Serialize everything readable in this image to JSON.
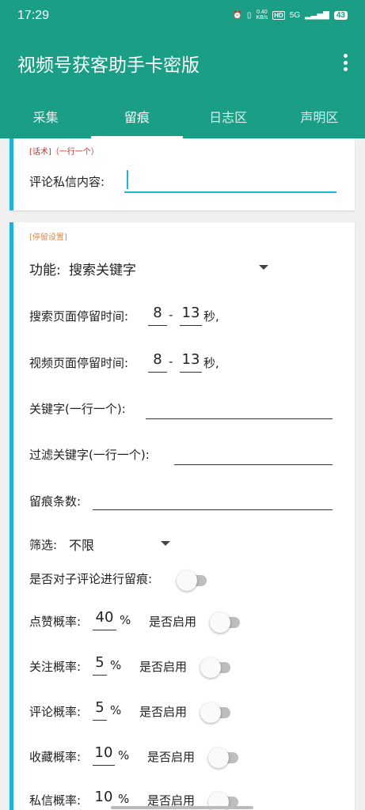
{
  "status_bar": {
    "time": "17:29",
    "net_speed": "0.40",
    "net_unit": "KB/s",
    "hd": "HD",
    "network": "5G",
    "battery": "43"
  },
  "app": {
    "title": "视频号获客助手卡密版"
  },
  "tabs": [
    {
      "label": "采集"
    },
    {
      "label": "留痕"
    },
    {
      "label": "日志区"
    },
    {
      "label": "声明区"
    }
  ],
  "script_section": {
    "tag": "[话术]（一行一个）",
    "comment_label": "评论私信内容:",
    "comment_value": ""
  },
  "stay_section": {
    "tag": "[停留设置]",
    "function_label": "功能:",
    "function_value": "搜索关键字",
    "search_stay_label": "搜索页面停留时间:",
    "search_min": "8",
    "search_max": "13",
    "video_stay_label": "视频页面停留时间:",
    "video_min": "8",
    "video_max": "13",
    "dash": "-",
    "sec_unit": "秒,",
    "keyword_label": "关键字(一行一个):",
    "filter_keyword_label": "过滤关键字(一行一个):",
    "count_label": "留痕条数:",
    "screen_label": "筛选:",
    "screen_value": "不限",
    "sub_comment_label": "是否对子评论进行留痕:",
    "percent": "%",
    "enable_label": "是否启用",
    "rates": [
      {
        "label": "点赞概率:",
        "value": "40"
      },
      {
        "label": "关注概率:",
        "value": "5"
      },
      {
        "label": "评论概率:",
        "value": "5"
      },
      {
        "label": "收藏概率:",
        "value": "10"
      },
      {
        "label": "私信概率:",
        "value": "10"
      }
    ]
  },
  "colors": {
    "primary": "#1a9e86",
    "accent": "#1fb3d6",
    "tag_red": "#c0302a",
    "tag_orange": "#d98a4a"
  }
}
